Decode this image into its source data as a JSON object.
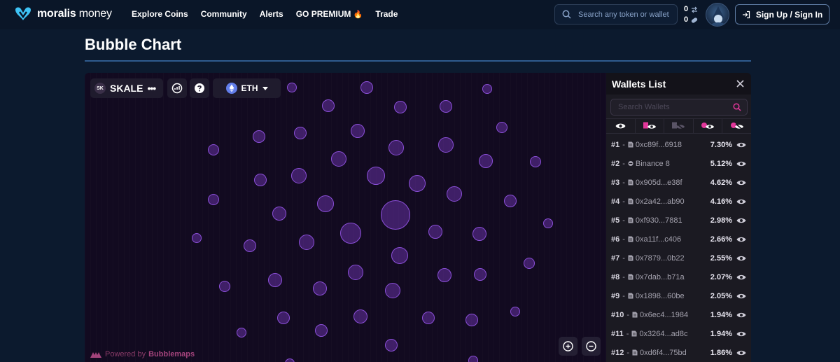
{
  "nav": {
    "logo_bold": "moralis",
    "logo_light": " money",
    "links": [
      {
        "label": "Explore Coins"
      },
      {
        "label": "Community"
      },
      {
        "label": "Alerts"
      },
      {
        "label": "GO PREMIUM"
      },
      {
        "label": "Trade"
      }
    ],
    "search_placeholder": "Search any token or wallet",
    "counter_alerts": "0",
    "counter_tokens": "0",
    "signup_label": "Sign Up / Sign In"
  },
  "page": {
    "title": "Bubble Chart"
  },
  "chart": {
    "token_logo_text": "SK",
    "token_name": "SKALE",
    "network": "ETH",
    "powered_prefix": "Powered by",
    "powered_brand": "Bubblemaps",
    "bubble_color": "#8b4fd8"
  },
  "wallets": {
    "title": "Wallets List",
    "search_placeholder": "Search Wallets",
    "rows": [
      {
        "rank": "#1",
        "type": "wallet",
        "address": "0xc89f...6918",
        "percent": "7.30%"
      },
      {
        "rank": "#2",
        "type": "exchange",
        "address": "Binance 8",
        "percent": "5.12%"
      },
      {
        "rank": "#3",
        "type": "wallet",
        "address": "0x905d...e38f",
        "percent": "4.62%"
      },
      {
        "rank": "#4",
        "type": "wallet",
        "address": "0x2a42...ab90",
        "percent": "4.16%"
      },
      {
        "rank": "#5",
        "type": "wallet",
        "address": "0xf930...7881",
        "percent": "2.98%"
      },
      {
        "rank": "#6",
        "type": "wallet",
        "address": "0xa11f...c406",
        "percent": "2.66%"
      },
      {
        "rank": "#7",
        "type": "wallet",
        "address": "0x7879...0b22",
        "percent": "2.55%"
      },
      {
        "rank": "#8",
        "type": "wallet",
        "address": "0x7dab...b71a",
        "percent": "2.07%"
      },
      {
        "rank": "#9",
        "type": "wallet",
        "address": "0x1898...60be",
        "percent": "2.05%"
      },
      {
        "rank": "#10",
        "type": "wallet",
        "address": "0x6ec4...1984",
        "percent": "1.94%"
      },
      {
        "rank": "#11",
        "type": "wallet",
        "address": "0x3264...ad8c",
        "percent": "1.94%"
      },
      {
        "rank": "#12",
        "type": "wallet",
        "address": "0xd6f4...75bd",
        "percent": "1.86%"
      }
    ]
  },
  "colors": {
    "accent_pink": "#e2379a",
    "brand_blue": "#3ec3f5"
  }
}
